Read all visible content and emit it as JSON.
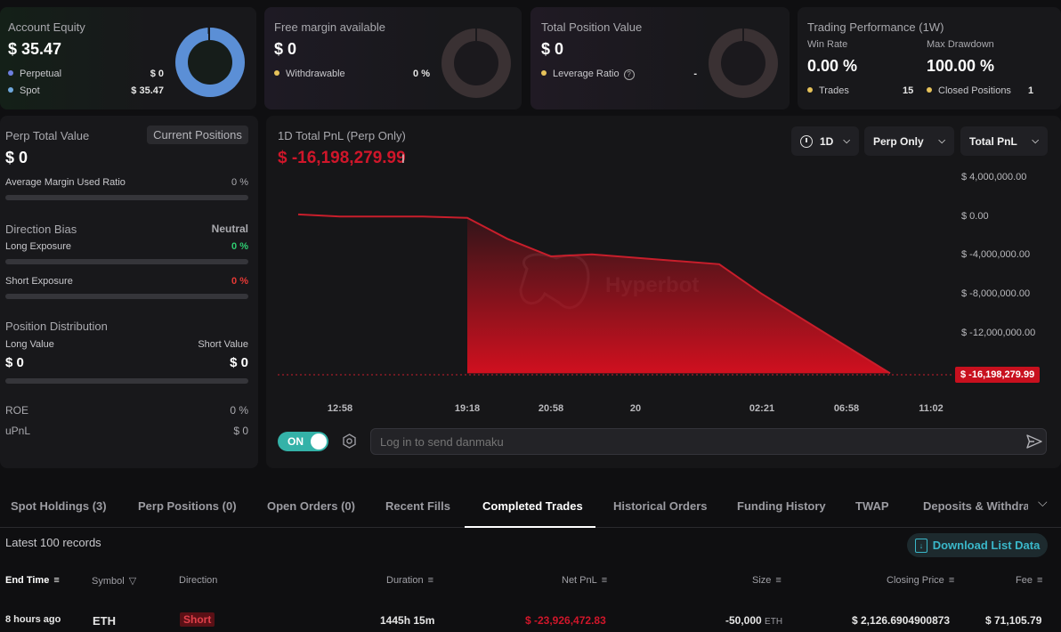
{
  "account_equity": {
    "title": "Account Equity",
    "value": "$ 35.47",
    "rows": [
      {
        "label": "Perpetual",
        "value": "$ 0",
        "color": "#6d7fe0"
      },
      {
        "label": "Spot",
        "value": "$ 35.47",
        "color": "#6fa8dc"
      }
    ]
  },
  "free_margin": {
    "title": "Free margin available",
    "value": "$ 0",
    "row": {
      "label": "Withdrawable",
      "value": "0 %",
      "color": "#e6c25a"
    }
  },
  "total_position": {
    "title": "Total Position Value",
    "value": "$ 0",
    "row": {
      "label": "Leverage Ratio",
      "value": "-",
      "color": "#e6c25a"
    }
  },
  "trading_performance": {
    "title": "Trading Performance (1W)",
    "win_rate_label": "Win Rate",
    "win_rate": "0.00 %",
    "max_drawdown_label": "Max Drawdown",
    "max_drawdown": "100.00 %",
    "trades_label": "Trades",
    "trades": "15",
    "closed_label": "Closed Positions",
    "closed": "1"
  },
  "perp": {
    "title": "Perp Total Value",
    "current_positions_btn": "Current Positions",
    "value": "$ 0",
    "avg_margin_label": "Average Margin Used Ratio",
    "avg_margin_value": "0 %",
    "direction_bias_label": "Direction Bias",
    "direction_bias_value": "Neutral",
    "long_exposure_label": "Long Exposure",
    "long_exposure_value": "0 %",
    "short_exposure_label": "Short Exposure",
    "short_exposure_value": "0 %",
    "position_dist_label": "Position Distribution",
    "long_value_label": "Long Value",
    "short_value_label": "Short Value",
    "long_value": "$ 0",
    "short_value": "$ 0",
    "roe_label": "ROE",
    "roe_value": "0 %",
    "upnl_label": "uPnL",
    "upnl_value": "$ 0"
  },
  "pnl": {
    "title": "1D Total PnL (Perp Only)",
    "value": "$ -16,198,279.99",
    "period": "1D",
    "scope": "Perp Only",
    "metric": "Total PnL",
    "watermark": "Hyperbot",
    "current_label": "$ -16,198,279.99",
    "toggle_label": "ON",
    "danmaku_placeholder": "Log in to send danmaku"
  },
  "chart_data": {
    "type": "area",
    "x": [
      "12:40",
      "12:58",
      "19:18",
      "19:40",
      "20:20",
      "20:58",
      "01:45",
      "02:21",
      "06:58",
      "11:02",
      "11:25"
    ],
    "values": [
      0.1,
      -0.12,
      -0.12,
      -0.25,
      -2.4,
      -4.2,
      -4.0,
      -5.0,
      -8.0,
      -16.2,
      -16.2
    ],
    "y_unit": "millions of $",
    "x_tick_labels": [
      "12:58",
      "19:18",
      "20:58",
      "20",
      "02:21",
      "06:58",
      "11:02"
    ],
    "y_tick_labels": [
      "$ 4,000,000.00",
      "$ 0.00",
      "$ -4,000,000.00",
      "$ -8,000,000.00",
      "$ -12,000,000.00"
    ],
    "ylim": [
      -16198279.99,
      4000000
    ],
    "line_color": "#c81e2b",
    "fill_color": "#d0101f"
  },
  "tabs": [
    {
      "label": "Spot Holdings (3)",
      "active": false
    },
    {
      "label": "Perp Positions (0)",
      "active": false
    },
    {
      "label": "Open Orders (0)",
      "active": false
    },
    {
      "label": "Recent Fills",
      "active": false
    },
    {
      "label": "Completed Trades",
      "active": true
    },
    {
      "label": "Historical Orders",
      "active": false
    },
    {
      "label": "Funding History",
      "active": false
    },
    {
      "label": "TWAP",
      "active": false
    },
    {
      "label": "Deposits & Withdraw",
      "active": false
    }
  ],
  "table": {
    "records_label": "Latest 100 records",
    "download_label": "Download List Data",
    "headers": [
      "End Time",
      "Symbol",
      "Direction",
      "Duration",
      "Net PnL",
      "Size",
      "Closing Price",
      "Fee"
    ],
    "row": {
      "end_time": "8 hours ago",
      "symbol": "ETH",
      "direction": "Short",
      "duration": "1445h 15m",
      "net_pnl": "$ -23,926,472.83",
      "size": "-50,000",
      "size_unit": "ETH",
      "closing_price": "$ 2,126.6904900873",
      "fee": "$ 71,105.79"
    }
  }
}
